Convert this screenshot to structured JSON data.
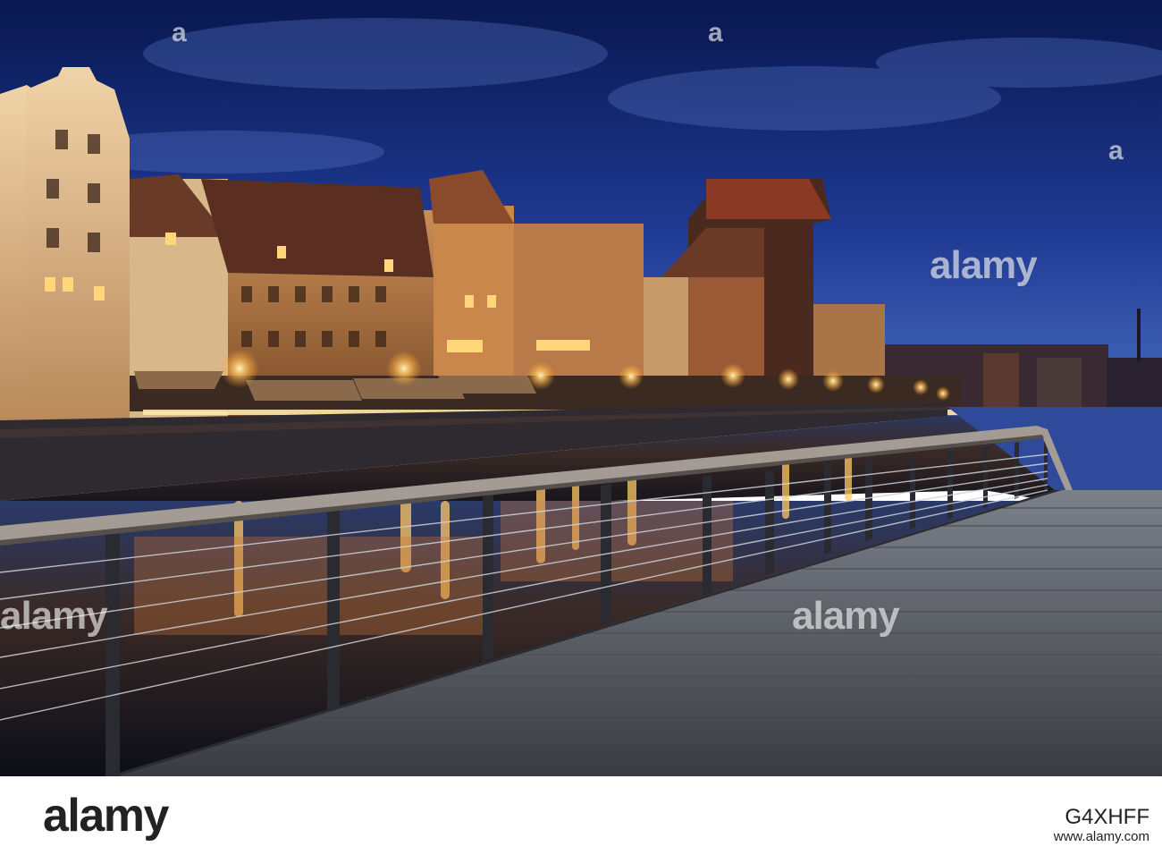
{
  "photo": {
    "scene": "Old town riverside at dusk with medieval crane, illuminated facades, river reflections and wooden boardwalk with cable railing",
    "palette": {
      "sky_top": "#0b1d5c",
      "sky_bottom": "#3b5bb0",
      "water": "#1b2540",
      "light": "#ffcf6a",
      "boardwalk": "#6b6f78"
    }
  },
  "watermark": {
    "brand": "alamy",
    "small": "a"
  },
  "footer": {
    "logo": "alamy",
    "image_id": "G4XHFF",
    "url": "www.alamy.com"
  }
}
